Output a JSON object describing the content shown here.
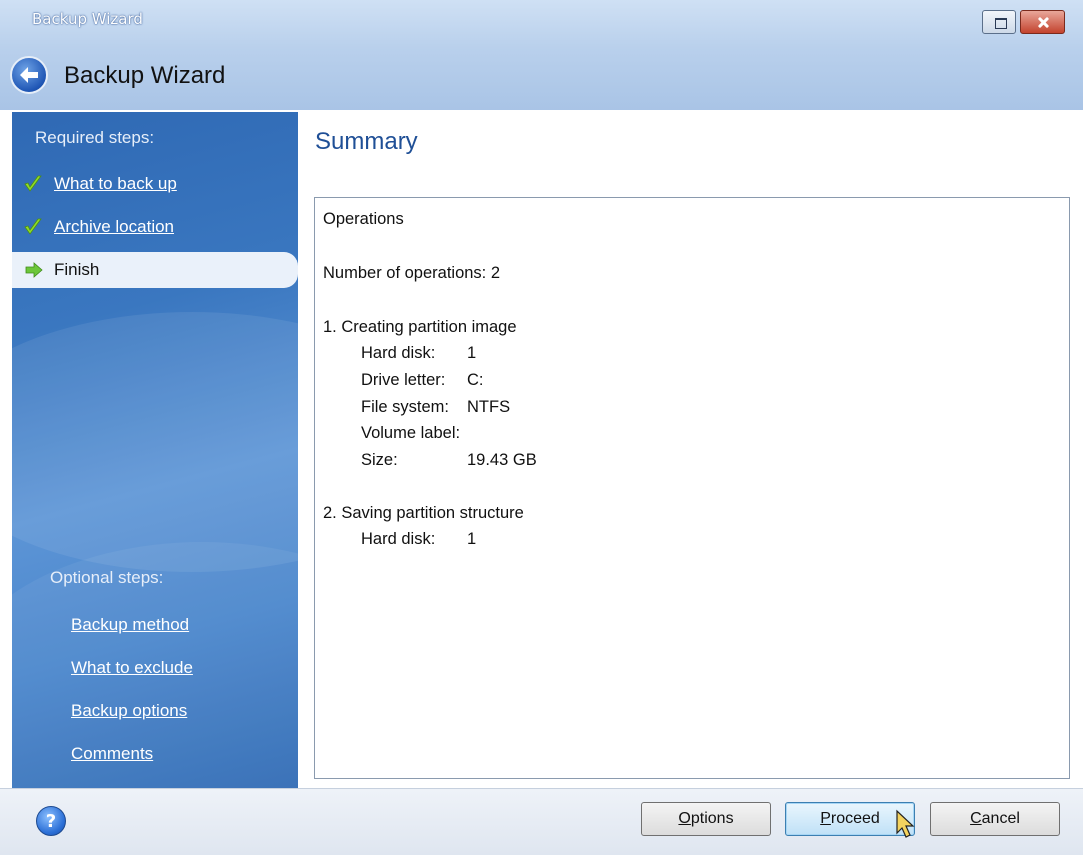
{
  "window": {
    "title": "Backup Wizard"
  },
  "header": {
    "title": "Backup Wizard"
  },
  "sidebar": {
    "required_heading": "Required steps:",
    "required_steps": [
      {
        "label": "What to back up",
        "status": "done"
      },
      {
        "label": "Archive location",
        "status": "done"
      },
      {
        "label": "Finish",
        "status": "current"
      }
    ],
    "optional_heading": "Optional steps:",
    "optional_steps": [
      {
        "label": "Backup method"
      },
      {
        "label": "What to exclude"
      },
      {
        "label": "Backup options"
      },
      {
        "label": "Comments"
      }
    ]
  },
  "main": {
    "title": "Summary",
    "summary": {
      "heading": "Operations",
      "count_line": "Number of operations: 2",
      "op1_title": "1. Creating partition image",
      "op1_fields": [
        {
          "key": "Hard disk:",
          "value": "1"
        },
        {
          "key": "Drive letter:",
          "value": "C:"
        },
        {
          "key": "File system:",
          "value": "NTFS"
        },
        {
          "key": "Volume label:",
          "value": ""
        },
        {
          "key": "Size:",
          "value": "19.43 GB"
        }
      ],
      "op2_title": "2. Saving partition structure",
      "op2_fields": [
        {
          "key": "Hard disk:",
          "value": "1"
        }
      ]
    }
  },
  "footer": {
    "help_label": "?",
    "options_first": "O",
    "options_rest": "ptions",
    "proceed_first": "P",
    "proceed_rest": "roceed",
    "cancel_first": "C",
    "cancel_rest": "ancel"
  },
  "colors": {
    "accent": "#1f4f96",
    "sidebar": "#3a77c0",
    "check": "#7ed321"
  }
}
